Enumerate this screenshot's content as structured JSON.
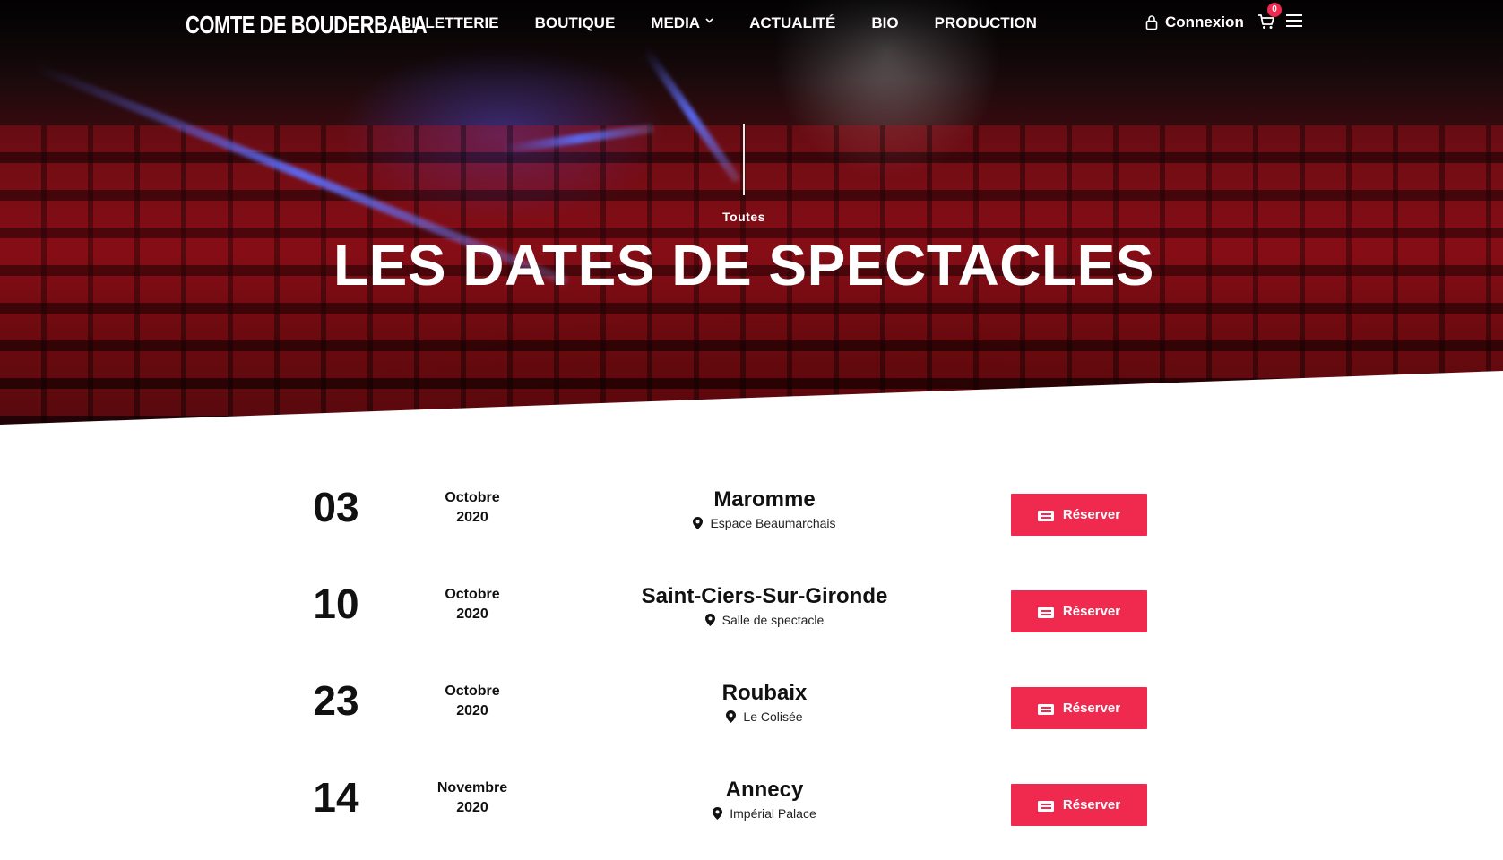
{
  "brand": {
    "logo": "COMTE DE BOUDERBALA"
  },
  "nav": {
    "items": [
      {
        "label": "BILLETTERIE"
      },
      {
        "label": "BOUTIQUE"
      },
      {
        "label": "MEDIA",
        "icon": "chevron-down-icon"
      },
      {
        "label": "ACTUALITÉ"
      },
      {
        "label": "BIO"
      },
      {
        "label": "PRODUCTION"
      }
    ],
    "login_label": "Connexion",
    "cart_count": "0"
  },
  "hero": {
    "eyebrow": "Toutes",
    "title": "LES DATES DE SPECTACLES"
  },
  "events": [
    {
      "day": "03",
      "month": "Octobre",
      "year": "2020",
      "city": "Maromme",
      "venue": "Espace Beaumarchais",
      "button": "Réserver"
    },
    {
      "day": "10",
      "month": "Octobre",
      "year": "2020",
      "city": "Saint-Ciers-Sur-Gironde",
      "venue": "Salle de spectacle",
      "button": "Réserver"
    },
    {
      "day": "23",
      "month": "Octobre",
      "year": "2020",
      "city": "Roubaix",
      "venue": "Le Colisée",
      "button": "Réserver"
    },
    {
      "day": "14",
      "month": "Novembre",
      "year": "2020",
      "city": "Annecy",
      "venue": "Impérial Palace",
      "button": "Réserver"
    }
  ],
  "colors": {
    "accent": "#f02a4f",
    "text": "#111111"
  }
}
